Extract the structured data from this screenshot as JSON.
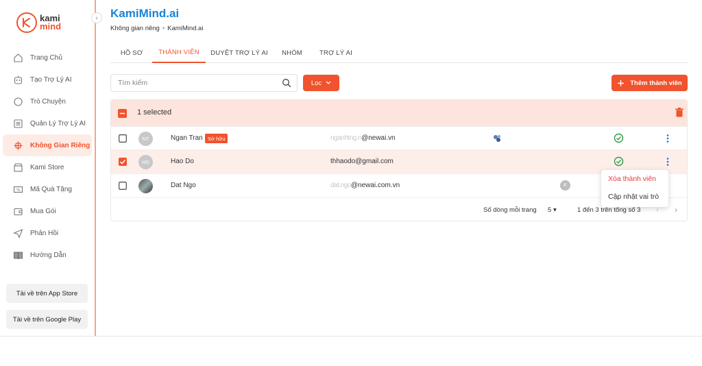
{
  "brand": {
    "line1": "kami",
    "line2": "mind",
    "mark": "K",
    "accent": "#f0532d",
    "link_color": "#1a83d6"
  },
  "sidebar": {
    "items": [
      {
        "label": "Trang Chủ",
        "icon": "home-icon",
        "glyph": "⌂"
      },
      {
        "label": "Tạo Trợ Lý AI",
        "icon": "create-assistant-icon",
        "glyph": "◎"
      },
      {
        "label": "Trò Chuyện",
        "icon": "chat-icon",
        "glyph": "○"
      },
      {
        "label": "Quản Lý Trợ Lý AI",
        "icon": "manage-list-icon",
        "glyph": "☰"
      },
      {
        "label": "Không Gian Riêng",
        "icon": "private-space-icon",
        "glyph": "✣",
        "active": true
      },
      {
        "label": "Kami Store",
        "icon": "store-icon",
        "glyph": "▭"
      },
      {
        "label": "Mã Quà Tặng",
        "icon": "voucher-icon",
        "glyph": "%"
      },
      {
        "label": "Mua Gói",
        "icon": "wallet-icon",
        "glyph": "▣"
      },
      {
        "label": "Phản Hồi",
        "icon": "send-icon",
        "glyph": "➤"
      },
      {
        "label": "Hướng Dẫn",
        "icon": "guide-book-icon",
        "glyph": "▤"
      }
    ],
    "app_store": "Tải về trên App Store",
    "google_play": "Tải về trên Google Play"
  },
  "header": {
    "title": "KamiMind.ai",
    "breadcrumb": [
      "Không gian riêng",
      "KamiMind.ai"
    ]
  },
  "tabs": [
    {
      "label": "HỒ SƠ"
    },
    {
      "label": "THÀNH VIÊN",
      "active": true
    },
    {
      "label": "DUYỆT TRỢ LÝ AI"
    },
    {
      "label": "NHÓM"
    },
    {
      "label": "TRỢ LÝ AI"
    }
  ],
  "toolbar": {
    "search_placeholder": "Tìm kiếm",
    "filter_label": "Lọc",
    "add_member_label": "Thêm thành viên"
  },
  "selection": {
    "text": "1 selected"
  },
  "members": [
    {
      "initials": "NT",
      "name": "Ngan Tran",
      "badge": "Sở hữu",
      "email_hidden": "nganhtng.n",
      "email_visible": "@newai.vn",
      "has_extra_icon": true,
      "verified": true,
      "selected": false
    },
    {
      "initials": "HD",
      "name": "Hao Do",
      "badge": "",
      "email_hidden": "thhaodo",
      "email_visible": "thhaodo@gmail.com",
      "verified": true,
      "selected": true
    },
    {
      "initials": "",
      "name": "Dat Ngo",
      "badge": "",
      "email_hidden": "dat.ngo",
      "email_visible": "@newai.com.vn",
      "small_avatar": "K",
      "verified": false,
      "selected": false,
      "photo": true
    }
  ],
  "pagination": {
    "rows_per_page_label": "Số dòng mỗi trang",
    "rows_per_page": "5",
    "range": "1 đến 3 trên tổng số 3"
  },
  "context_menu": {
    "remove": "Xóa thành viên",
    "update_role": "Cập nhật vai trò"
  }
}
